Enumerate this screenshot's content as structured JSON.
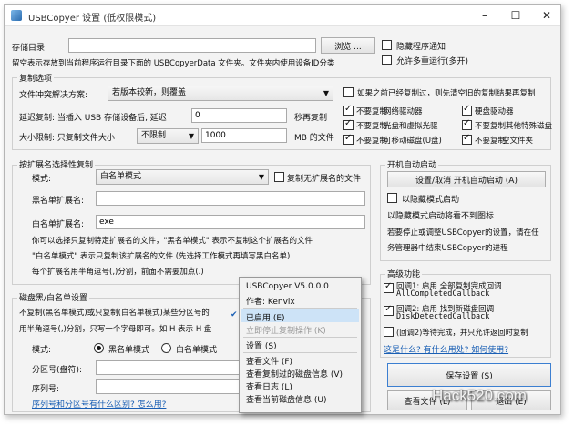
{
  "title": "USBCopyer 设置 (低权限模式)",
  "store_dir_label": "存储目录:",
  "store_dir_value": "",
  "browse_btn": "浏览 ...",
  "hide_notify": "隐藏程序通知",
  "allow_multi": "允许多重运行(多开)",
  "note_line": "留空表示存放到当前程序运行目录下面的 USBCopyerData 文件夹。文件夹内使用设备ID分类",
  "copy_opts": {
    "title": "复制选项",
    "conflict_label": "文件冲突解决方案:",
    "conflict_value": "若版本较新，则覆盖",
    "delay_label": "延迟复制: 当插入 USB 存储设备后, 延迟",
    "delay_value": "0",
    "delay_unit": "秒再复制",
    "size_label": "大小限制: 只复制文件大小",
    "size_mode": "不限制",
    "size_value": "1000",
    "size_unit": "MB 的文件",
    "resume": "如果之前已经复制过，则先清空旧的复制结果再复制",
    "drives": [
      {
        "label": "不要复制",
        "checked": true
      },
      {
        "label": "网络驱动器",
        "checked": true
      },
      {
        "label": "硬盘驱动器",
        "checked": true
      },
      {
        "label": "不要复制",
        "checked": true
      },
      {
        "label": "光盘和虚拟光驱",
        "checked": true
      },
      {
        "label": "不要复制其他特殊磁盘",
        "checked": true
      },
      {
        "label": "不要复制",
        "checked": true
      },
      {
        "label": "可移动磁盘(U盘)",
        "checked": false
      },
      {
        "label": "不要复制",
        "checked": true
      },
      {
        "label": "空文件夹",
        "checked": false
      }
    ]
  },
  "ext": {
    "title": "按扩展名选择性复制",
    "mode_label": "模式:",
    "mode_value": "白名单模式",
    "copy_noext": "复制无扩展名的文件",
    "black_label": "黑名单扩展名:",
    "black_value": "",
    "white_label": "白名单扩展名:",
    "white_value": "exe",
    "help1": "你可以选择只复制特定扩展名的文件，\"黑名单模式\" 表示不复制这个扩展名的文件",
    "help2": "\"白名单模式\" 表示只复制该扩展名的文件  (先选择工作模式再填写黑白名单)",
    "help3": "每个扩展名用半角逗号(,)分割，前面不需要加点(.)"
  },
  "disk": {
    "title": "磁盘黑/白名单设置",
    "line1": "不复制(黑名单模式)或只复制(白名单模式)某些分区号的",
    "line2": "用半角逗号(,)分割，只写一个字母即可。如 H 表示 H 盘",
    "mode_label": "模式:",
    "black": "黑名单模式",
    "white": "白名单模式",
    "part_label": "分区号(盘符):",
    "serial_label": "序列号:",
    "link": "序列号和分区号有什么区别? 怎么用?"
  },
  "startup": {
    "title": "开机自动启动",
    "toggle_btn": "设置/取消 开机自动启动 (A)",
    "hidden": "以隐藏模式启动",
    "hidden_note": "以隐藏模式启动将看不到图标",
    "stop_note1": "若要停止或调整USBCopyer的设置，请在任",
    "stop_note2": "务管理器中结束USBCopyer的进程"
  },
  "advanced": {
    "title": "高级功能",
    "cb1a": "回调1: 启用 全部复制完成回调",
    "cb1b": "AllCompletedCallback",
    "cb2a": "回调2: 启用 找到新磁盘回调",
    "cb2b": "DiskDetectedCallback",
    "cb3": "(回调2)等待完成，并只允许返回时复制",
    "link": "这是什么? 有什么用处? 如何使用?"
  },
  "save_btn": "保存设置 (S)",
  "view_file_btn": "查看文件 (L)",
  "exit_btn": "退出 (E)",
  "watermark": "Hack520.com",
  "menu": {
    "version": "USBCopyer V5.0.0.0",
    "author": "作者: Kenvix",
    "enabled": "已启用 (E)",
    "stop_now": "立即停止复制操作 (K)",
    "settings": "设置 (S)",
    "view_files": "查看文件 (F)",
    "view_copied": "查看复制过的磁盘信息 (V)",
    "view_log": "查看日志 (L)",
    "view_current": "查看当前磁盘信息 (U)"
  }
}
